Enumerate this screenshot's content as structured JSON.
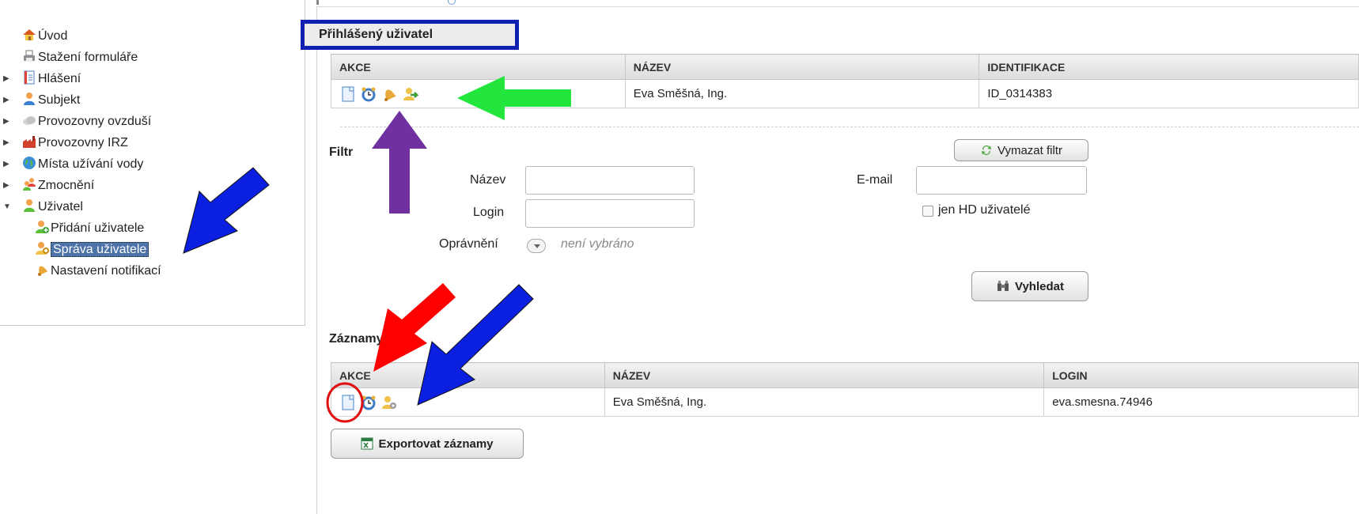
{
  "sidebar": {
    "items": [
      {
        "label": "Úvod",
        "icon": "home-icon",
        "expander": ""
      },
      {
        "label": "Stažení formuláře",
        "icon": "printer-icon",
        "expander": ""
      },
      {
        "label": "Hlášení",
        "icon": "document-icon",
        "expander": "▶"
      },
      {
        "label": "Subjekt",
        "icon": "person-icon",
        "expander": "▶"
      },
      {
        "label": "Provozovny ovzduší",
        "icon": "cloud-icon",
        "expander": "▶"
      },
      {
        "label": "Provozovny IRZ",
        "icon": "factory-icon",
        "expander": "▶"
      },
      {
        "label": "Místa užívání vody",
        "icon": "globe-icon",
        "expander": "▶"
      },
      {
        "label": "Zmocnění",
        "icon": "users-icon",
        "expander": "▶"
      },
      {
        "label": "Uživatel",
        "icon": "person-icon",
        "expander": "▼"
      },
      {
        "label": "Přidání uživatele",
        "icon": "add-user-icon",
        "expander": ""
      },
      {
        "label": "Správa uživatele",
        "icon": "user-key-icon",
        "expander": ""
      },
      {
        "label": "Nastavení notifikací",
        "icon": "bell-icon",
        "expander": ""
      }
    ]
  },
  "logged_user": {
    "title": "Přihlášený uživatel",
    "headers": {
      "akce": "AKCE",
      "nazev": "NÁZEV",
      "identifikace": "IDENTIFIKACE"
    },
    "row": {
      "nazev": "Eva Směšná, Ing.",
      "identifikace": "ID_0314383"
    }
  },
  "filter": {
    "title": "Filtr",
    "clear_label": "Vymazat filtr",
    "name_label": "Název",
    "login_label": "Login",
    "email_label": "E-mail",
    "perm_label": "Oprávnění",
    "perm_value": "není vybráno",
    "hd_label": "jen HD uživatelé",
    "search_label": "Vyhledat"
  },
  "records": {
    "title": "Záznamy",
    "headers": {
      "akce": "AKCE",
      "nazev": "NÁZEV",
      "login": "LOGIN"
    },
    "row": {
      "nazev": "Eva Směšná, Ing.",
      "login": "eva.smesna.74946"
    },
    "export_label": "Exportovat záznamy"
  },
  "colors": {
    "selection": "#4d73a8",
    "highlight_box": "#1020b0",
    "arrow_green": "#22e63c",
    "arrow_purple": "#7030a0",
    "arrow_blue": "#0a1fe0",
    "arrow_red": "#ff0000",
    "circle_red": "#e01010"
  }
}
